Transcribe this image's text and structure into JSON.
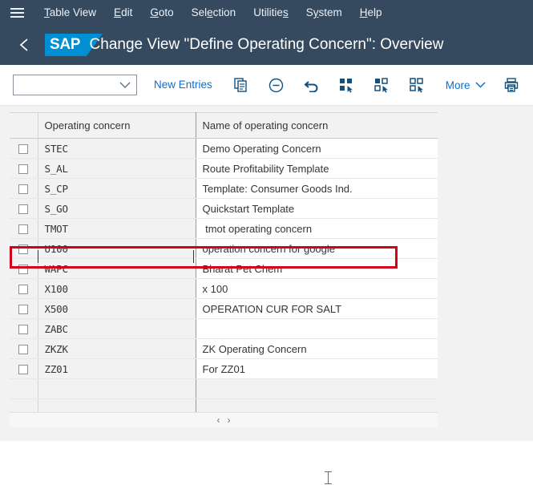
{
  "menu": {
    "hamburger_icon": "hamburger-menu-icon",
    "items": [
      {
        "label": "Table View",
        "accel_index": 0
      },
      {
        "label": "Edit",
        "accel_index": 0
      },
      {
        "label": "Goto",
        "accel_index": 0
      },
      {
        "label": "Selection",
        "accel_index": 2
      },
      {
        "label": "Utilities",
        "accel_index": 8
      },
      {
        "label": "System",
        "accel_index": 1
      },
      {
        "label": "Help",
        "accel_index": 0
      }
    ]
  },
  "shell": {
    "back_icon": "back-chevron-icon",
    "logo_text": "SAP",
    "title": "Change View \"Define Operating Concern\": Overview"
  },
  "toolbar": {
    "variant_value": "",
    "variant_placeholder": "",
    "dropdown_icon": "chevron-down-icon",
    "new_entries_label": "New Entries",
    "icons": [
      {
        "name": "copy-icon"
      },
      {
        "name": "delete-minus-icon"
      },
      {
        "name": "undo-icon"
      },
      {
        "name": "select-all-icon"
      },
      {
        "name": "select-block-icon"
      },
      {
        "name": "deselect-all-icon"
      }
    ],
    "more_label": "More",
    "more_icon": "chevron-down-icon",
    "print_icon": "printer-icon"
  },
  "table": {
    "columns": [
      "Operating concern",
      "Name of operating concern"
    ],
    "rows": [
      {
        "key": "STEC",
        "name": "Demo Operating Concern",
        "highlighted": true
      },
      {
        "key": "S_AL",
        "name": "Route Profitability Template",
        "highlighted": false
      },
      {
        "key": "S_CP",
        "name": "Template: Consumer Goods Ind.",
        "highlighted": false
      },
      {
        "key": "S_GO",
        "name": "Quickstart Template",
        "highlighted": false
      },
      {
        "key": "TMOT",
        "name": " tmot operating concern",
        "highlighted": false
      },
      {
        "key": "U100",
        "name": "operation concern for google",
        "highlighted": false
      },
      {
        "key": "WAPC",
        "name": "Bharat Pet Chem",
        "highlighted": false
      },
      {
        "key": "X100",
        "name": "x 100",
        "highlighted": false
      },
      {
        "key": "X500",
        "name": "OPERATION CUR FOR SALT",
        "highlighted": false
      },
      {
        "key": "ZABC",
        "name": "",
        "highlighted": false
      },
      {
        "key": "ZKZK",
        "name": "ZK Operating Concern",
        "highlighted": false
      },
      {
        "key": "ZZ01",
        "name": "For ZZ01",
        "highlighted": false
      },
      {
        "key": "",
        "name": "",
        "highlighted": false
      },
      {
        "key": "",
        "name": "",
        "highlighted": false
      }
    ],
    "scroll_left_label": "‹",
    "scroll_right_label": "›"
  },
  "colors": {
    "shell_bg": "#354a5f",
    "logo_blue": "#008fd3",
    "accent_link": "#0a6ed1",
    "highlight_red": "#d0021b",
    "row_key_bg": "#f2f2f2"
  }
}
